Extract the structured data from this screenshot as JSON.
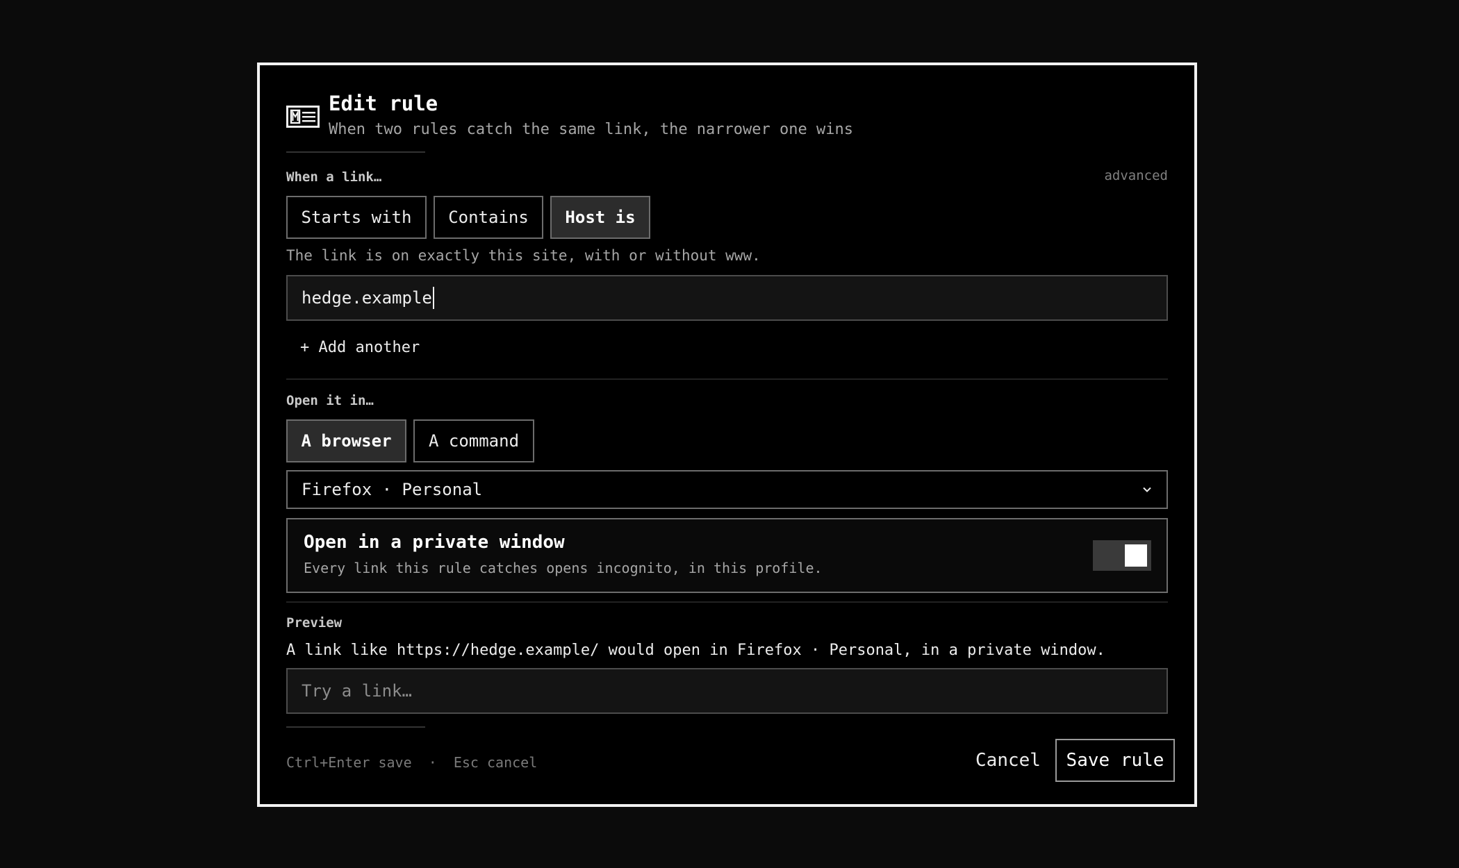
{
  "header": {
    "title": "Edit rule",
    "subtitle": "When two rules catch the same link, the narrower one wins",
    "icon": "link-card-icon"
  },
  "match": {
    "label": "When a link…",
    "advanced_label": "advanced",
    "options": [
      "Starts with",
      "Contains",
      "Host is"
    ],
    "selected": "Host is",
    "hint": "The link is on exactly this site, with or without www.",
    "value": "hedge.example",
    "add_another": "+ Add another"
  },
  "open_in": {
    "label": "Open it in…",
    "options": [
      "A browser",
      "A command"
    ],
    "selected": "A browser",
    "browser_value": "Firefox · Personal"
  },
  "private_window": {
    "title": "Open in a private window",
    "description": "Every link this rule catches opens incognito, in this profile.",
    "enabled": true
  },
  "preview": {
    "label": "Preview",
    "text": "A link like https://hedge.example/ would open in Firefox · Personal, in a private window.",
    "placeholder": "Try a link…"
  },
  "footer": {
    "shortcuts": "Ctrl+Enter save  ·  Esc cancel",
    "cancel_label": "Cancel",
    "save_label": "Save rule"
  },
  "colors": {
    "background": "#0b0b0b",
    "dialog": "#000000",
    "border": "#f2f2f2",
    "active_segment": "#2c2c2c"
  }
}
